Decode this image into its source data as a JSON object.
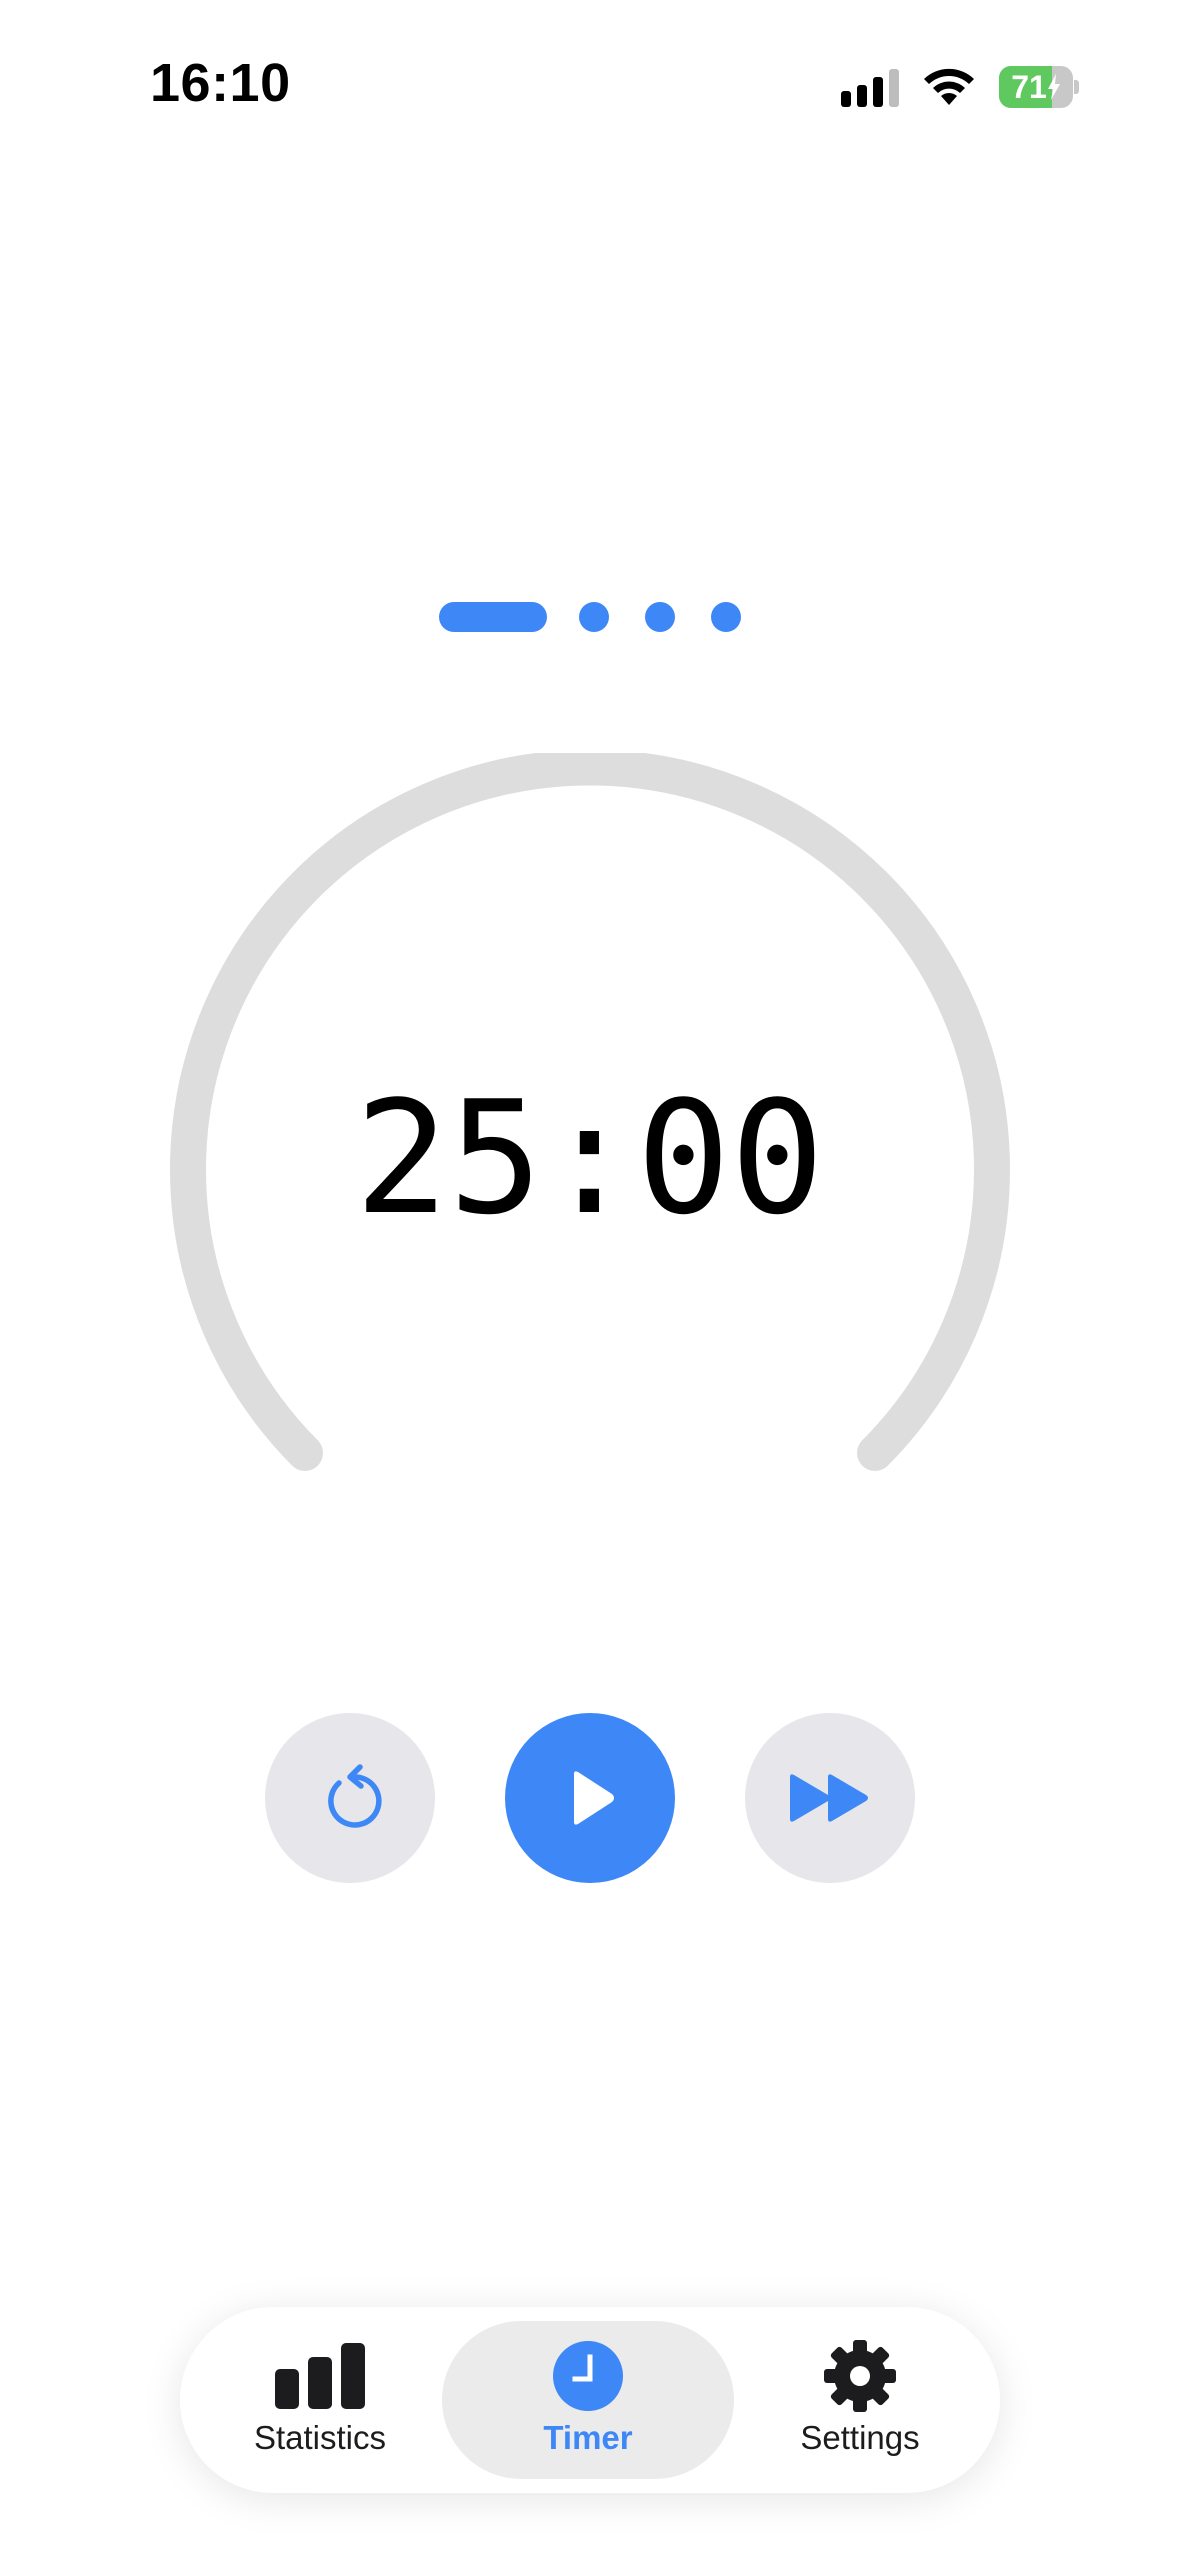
{
  "status_bar": {
    "time": "16:10",
    "battery_level": "71",
    "battery_fraction": 0.71,
    "charging": true,
    "signal_bars": 3,
    "signal_bars_total": 4
  },
  "pager": {
    "pages": 4,
    "active_index": 0,
    "accent_color": "#3d88f6"
  },
  "timer": {
    "display": "25:00",
    "progress_fraction": 0,
    "track_color": "#dddddd"
  },
  "controls": {
    "reset_icon": "reset-icon",
    "play_icon": "play-icon",
    "skip_icon": "fast-forward-icon",
    "primary_color": "#3d88f6",
    "secondary_color": "#e6e6eb"
  },
  "tabbar": {
    "tabs": [
      {
        "label": "Statistics",
        "icon": "bar-chart-icon",
        "selected": false
      },
      {
        "label": "Timer",
        "icon": "clock-icon",
        "selected": true
      },
      {
        "label": "Settings",
        "icon": "gear-icon",
        "selected": false
      }
    ]
  }
}
